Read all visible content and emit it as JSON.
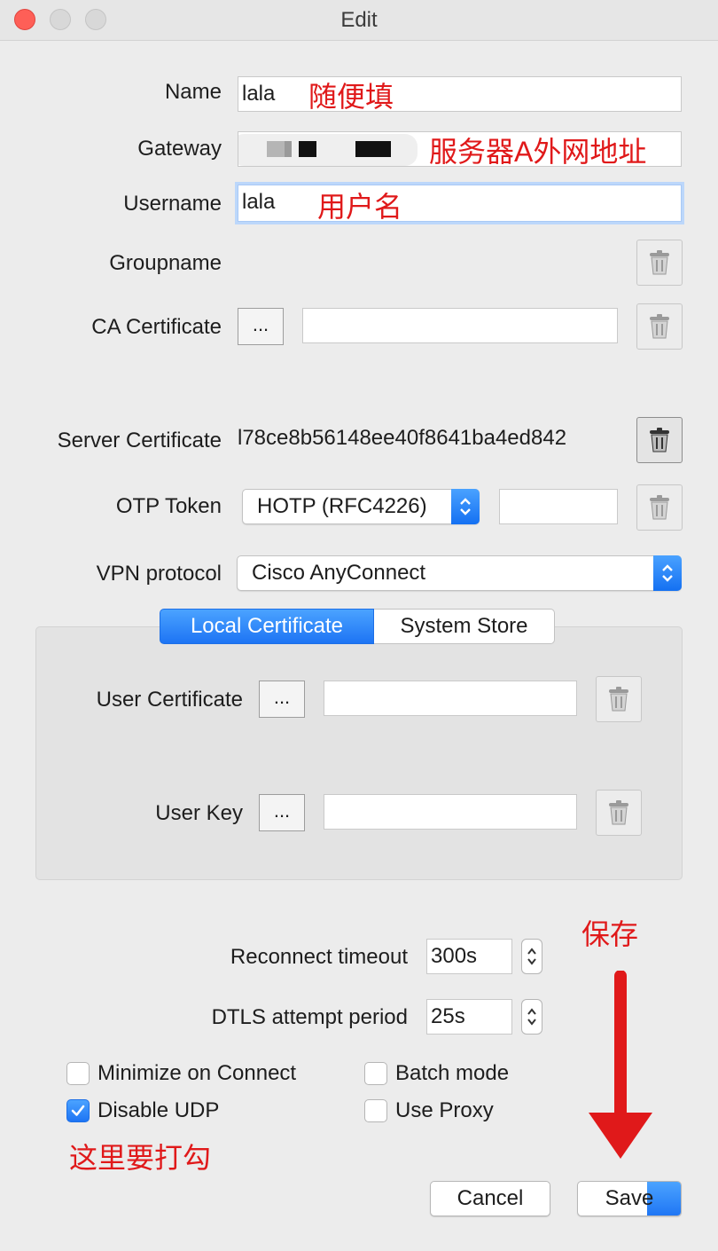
{
  "window": {
    "title": "Edit"
  },
  "form": {
    "name": {
      "label": "Name",
      "value": "lala",
      "annotation": "随便填"
    },
    "gateway": {
      "label": "Gateway",
      "annotation": "服务器A外网地址"
    },
    "username": {
      "label": "Username",
      "value": "lala",
      "annotation": "用户名"
    },
    "groupname": {
      "label": "Groupname"
    },
    "ca_certificate": {
      "label": "CA Certificate",
      "browse": "...",
      "value": ""
    },
    "server_certificate": {
      "label": "Server Certificate",
      "value": "l78ce8b56148ee40f8641ba4ed842"
    },
    "otp_token": {
      "label": "OTP Token",
      "selected": "HOTP (RFC4226)",
      "value": ""
    },
    "vpn_protocol": {
      "label": "VPN protocol",
      "selected": "Cisco AnyConnect"
    }
  },
  "cert_tabs": {
    "local": "Local Certificate",
    "system": "System Store",
    "active": "local"
  },
  "cert_group": {
    "user_certificate": {
      "label": "User Certificate",
      "browse": "...",
      "value": ""
    },
    "user_key": {
      "label": "User Key",
      "browse": "...",
      "value": ""
    }
  },
  "timeouts": {
    "reconnect": {
      "label": "Reconnect timeout",
      "value": "300s"
    },
    "dtls": {
      "label": "DTLS attempt period",
      "value": "25s"
    }
  },
  "options": {
    "minimize_on_connect": {
      "label": "Minimize on Connect",
      "checked": false
    },
    "batch_mode": {
      "label": "Batch mode",
      "checked": false
    },
    "disable_udp": {
      "label": "Disable UDP",
      "checked": true
    },
    "use_proxy": {
      "label": "Use Proxy",
      "checked": false
    }
  },
  "annotations": {
    "save_note": "保存",
    "check_note": "这里要打勾",
    "color": "#e0191a"
  },
  "buttons": {
    "cancel": "Cancel",
    "save": "Save"
  },
  "colors": {
    "accent": "#1d74f4",
    "close": "#fe5f57"
  }
}
